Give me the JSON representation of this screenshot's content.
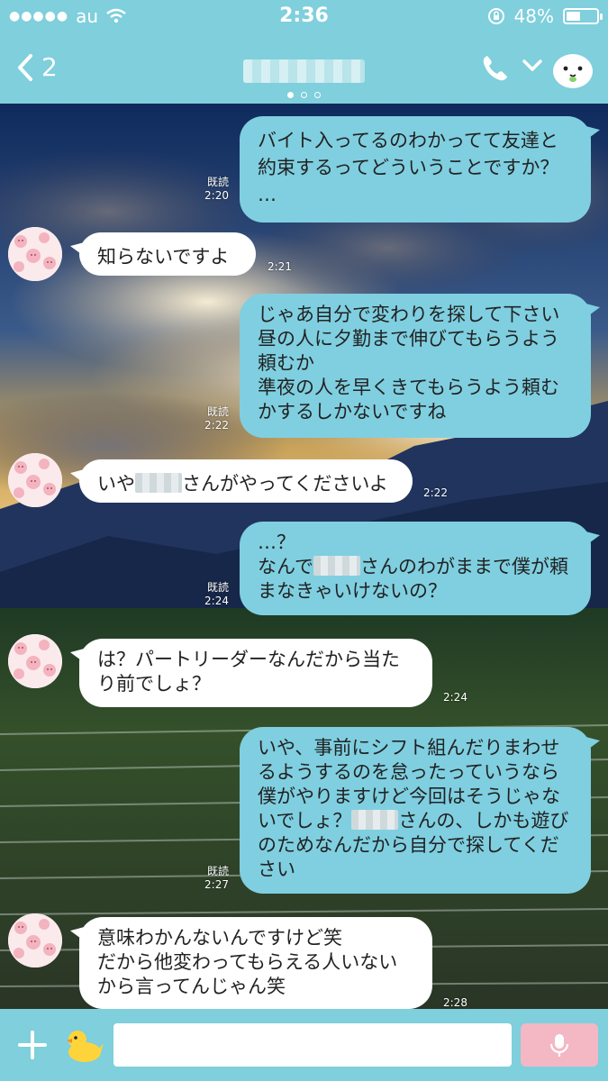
{
  "status_bar": {
    "carrier": "au",
    "time": "2:36",
    "battery_text": "48%",
    "battery_level": 0.48
  },
  "header": {
    "back_count": "2",
    "icons": [
      "chevron-left-icon",
      "phone-icon",
      "chevron-down-icon",
      "mascot-icon"
    ]
  },
  "messages": [
    {
      "side": "out",
      "text": "バイト入ってるのわかってて友達と\n約束するってどういうことですか？\n…",
      "read": "既読",
      "time": "2:20"
    },
    {
      "side": "in",
      "text": "知らないですよ",
      "time": "2:21"
    },
    {
      "side": "out",
      "text": "じゃあ自分で変わりを探して下さい\n昼の人に夕勤まで伸びてもらうよう\n頼むか\n準夜の人を早くきてもらうよう頼む\nかするしかないですね",
      "read": "既読",
      "time": "2:22"
    },
    {
      "side": "in",
      "text_before": "いや",
      "text_after": "さんがやってくださいよ",
      "time": "2:22"
    },
    {
      "side": "out",
      "text_line1": "…？",
      "text_before": "なんで",
      "text_after": "さんのわがままで僕が頼\nまなきゃいけないの？",
      "read": "既読",
      "time": "2:24"
    },
    {
      "side": "in",
      "text": "は？パートリーダーなんだから当た\nり前でしょ？",
      "time": "2:24"
    },
    {
      "side": "out",
      "text_before": "いや、事前にシフト組んだりまわせ\nるようするのを怠ったっていうなら\n僕がやりますけど今回はそうじゃな\nいでしょ？",
      "text_after": "さんの、しかも遊び\nのためなんだから自分で探してくだ\nさい",
      "read": "既読",
      "time": "2:27"
    },
    {
      "side": "in",
      "text": "意味わかんないんですけど笑\nだから他変わってもらえる人いない\nから言ってんじゃん笑",
      "time": "2:28"
    }
  ],
  "input_bar": {
    "placeholder": "",
    "icons": [
      "plus-icon",
      "duck-sticker-icon",
      "mic-icon"
    ]
  },
  "colors": {
    "header": "#7fcfdc",
    "outgoing_bubble": "#7fcfe0",
    "incoming_bubble": "#ffffff",
    "mic_button": "#f4b7c4"
  }
}
